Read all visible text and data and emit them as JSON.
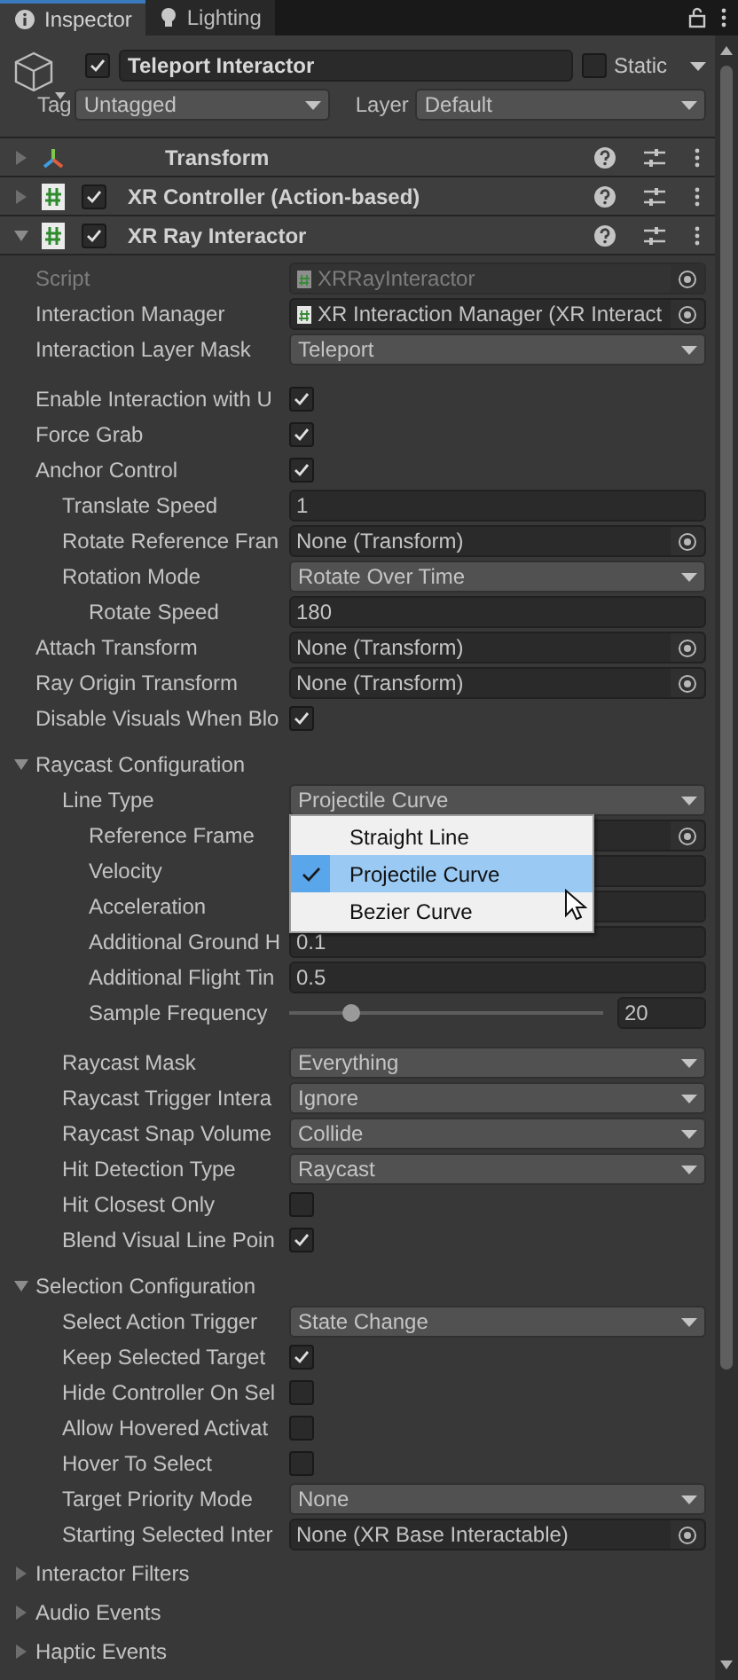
{
  "tabs": [
    {
      "kind": "info",
      "label": "Inspector",
      "selected": true
    },
    {
      "kind": "bulb",
      "label": "Lighting",
      "selected": false
    }
  ],
  "game_object": {
    "active": true,
    "name": "Teleport Interactor",
    "static": false,
    "static_label": "Static",
    "tag_label": "Tag",
    "tag": "Untagged",
    "layer_label": "Layer",
    "layer": "Default"
  },
  "components": [
    {
      "kind": "transform",
      "title": "Transform",
      "expanded": false
    },
    {
      "kind": "script",
      "title": "XR Controller (Action-based)",
      "enabled": true,
      "expanded": false
    },
    {
      "kind": "script",
      "title": "XR Ray Interactor",
      "enabled": true,
      "expanded": true,
      "script": {
        "label": "Script",
        "value": "XRRayInteractor",
        "disabled": true
      },
      "sections": [
        {
          "groups": [
            [
              {
                "kind": "asset",
                "label": "Interaction Manager",
                "value": "XR Interaction Manager (XR Interact"
              },
              {
                "kind": "dropdown",
                "label": "Interaction Layer Mask",
                "value": "Teleport"
              }
            ],
            [
              {
                "kind": "checkbox",
                "label": "Enable Interaction with U",
                "checked": true
              },
              {
                "kind": "checkbox",
                "label": "Force Grab",
                "checked": true
              },
              {
                "kind": "checkbox",
                "label": "Anchor Control",
                "checked": true,
                "children": [
                  {
                    "kind": "text",
                    "label": "Translate Speed",
                    "value": "1"
                  },
                  {
                    "kind": "object",
                    "label": "Rotate Reference Fran",
                    "value": "None (Transform)"
                  },
                  {
                    "kind": "dropdown",
                    "label": "Rotation Mode",
                    "value": "Rotate Over Time",
                    "children": [
                      {
                        "kind": "text",
                        "label": "Rotate Speed",
                        "value": "180"
                      }
                    ]
                  }
                ]
              },
              {
                "kind": "object",
                "label": "Attach Transform",
                "value": "None (Transform)"
              },
              {
                "kind": "object",
                "label": "Ray Origin Transform",
                "value": "None (Transform)"
              },
              {
                "kind": "checkbox",
                "label": "Disable Visuals When Blo",
                "checked": true
              }
            ]
          ]
        },
        {
          "title": "Raycast Configuration",
          "expanded": true,
          "groups": [
            [
              {
                "kind": "dropdown",
                "label": "Line Type",
                "value": "Projectile Curve",
                "children": [
                  {
                    "kind": "object",
                    "label": "Reference Frame"
                  },
                  {
                    "kind": "text",
                    "label": "Velocity"
                  },
                  {
                    "kind": "text",
                    "label": "Acceleration"
                  },
                  {
                    "kind": "text",
                    "label": "Additional Ground H",
                    "value": "0.1"
                  },
                  {
                    "kind": "text",
                    "label": "Additional Flight Tin",
                    "value": "0.5"
                  },
                  {
                    "kind": "slider",
                    "label": "Sample Frequency",
                    "level": 0.2,
                    "value": "20"
                  }
                ]
              }
            ],
            [
              {
                "kind": "dropdown",
                "label": "Raycast Mask",
                "value": "Everything"
              },
              {
                "kind": "dropdown",
                "label": "Raycast Trigger Intera",
                "value": "Ignore"
              },
              {
                "kind": "dropdown",
                "label": "Raycast Snap Volume",
                "value": "Collide"
              },
              {
                "kind": "dropdown",
                "label": "Hit Detection Type",
                "value": "Raycast"
              },
              {
                "kind": "checkbox",
                "label": "Hit Closest Only",
                "checked": false
              },
              {
                "kind": "checkbox",
                "label": "Blend Visual Line Poin",
                "checked": true
              }
            ]
          ]
        },
        {
          "title": "Selection Configuration",
          "expanded": true,
          "groups": [
            [
              {
                "kind": "dropdown",
                "label": "Select Action Trigger",
                "value": "State Change"
              },
              {
                "kind": "checkbox",
                "label": "Keep Selected Target",
                "checked": true
              },
              {
                "kind": "checkbox",
                "label": "Hide Controller On Sel",
                "checked": false
              },
              {
                "kind": "checkbox",
                "label": "Allow Hovered Activat",
                "checked": false
              },
              {
                "kind": "checkbox",
                "label": "Hover To Select",
                "checked": false
              },
              {
                "kind": "dropdown",
                "label": "Target Priority Mode",
                "value": "None"
              },
              {
                "kind": "object",
                "label": "Starting Selected Inter",
                "value": "None (XR Base Interactable)"
              }
            ]
          ]
        },
        {
          "title": "Interactor Filters",
          "expanded": false
        },
        {
          "title": "Audio Events",
          "expanded": false
        },
        {
          "title": "Haptic Events",
          "expanded": false
        }
      ]
    }
  ],
  "popup": {
    "items": [
      {
        "label": "Straight Line",
        "selected": false
      },
      {
        "label": "Projectile Curve",
        "selected": true
      },
      {
        "label": "Bezier Curve",
        "selected": false
      }
    ]
  }
}
